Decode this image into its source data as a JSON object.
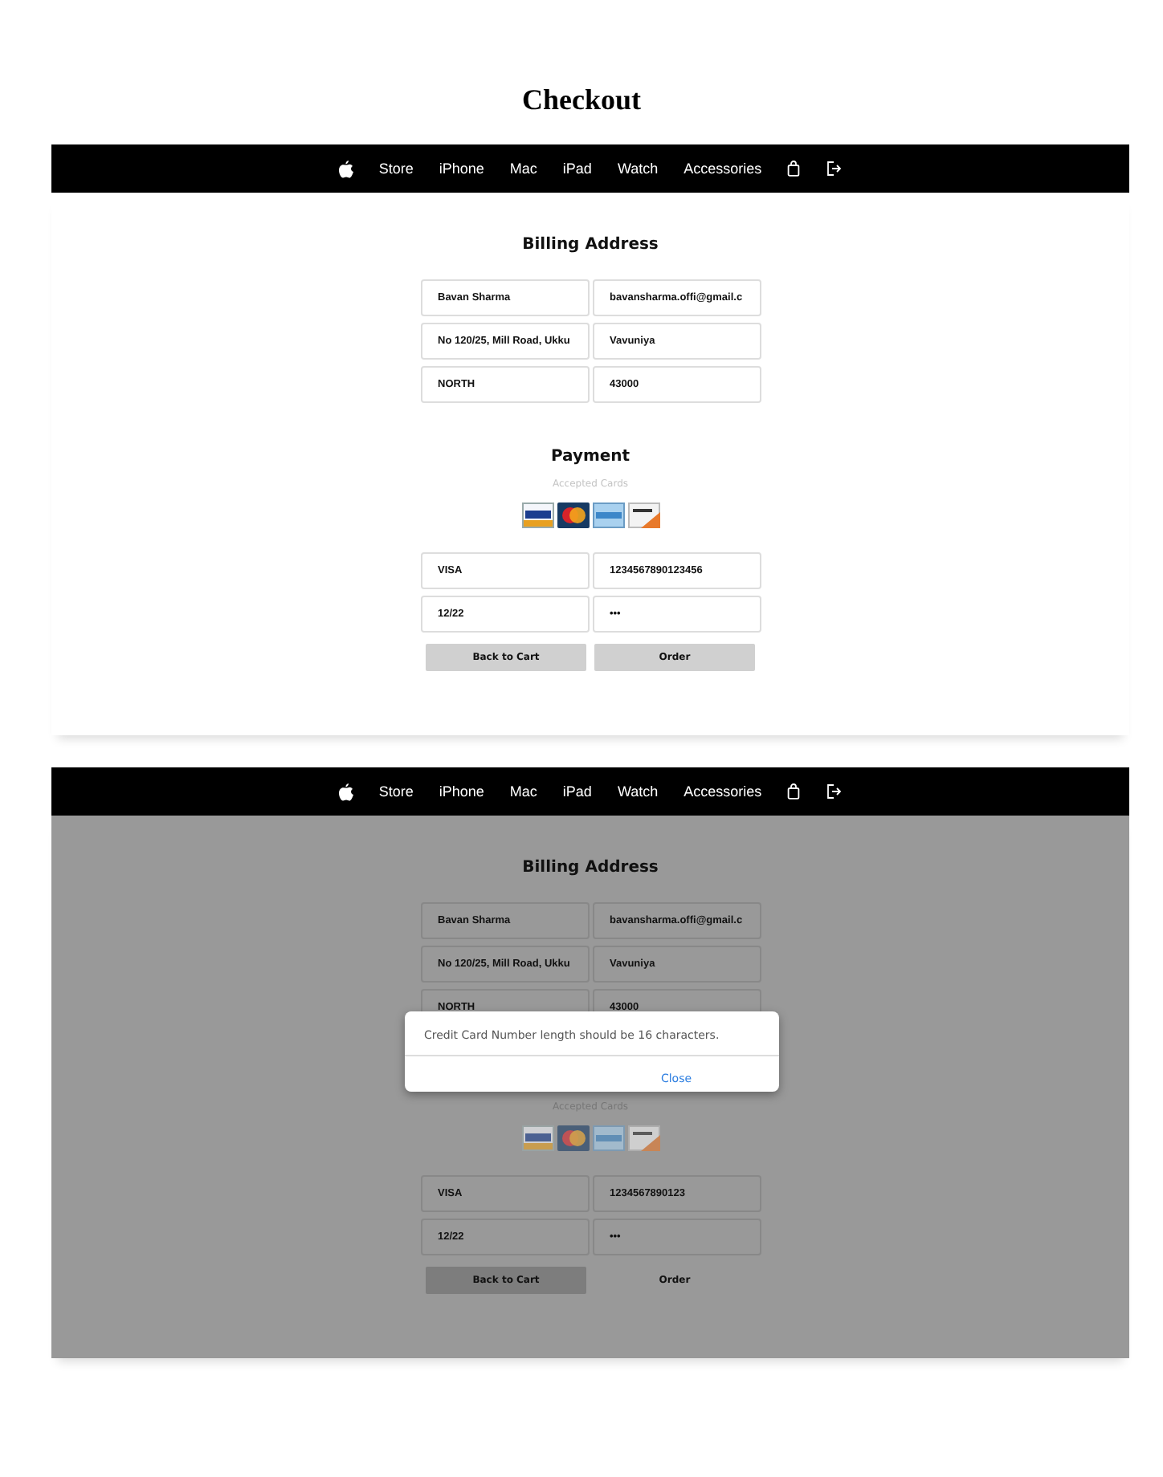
{
  "title": "Checkout",
  "screens": [
    {
      "dimmed": false,
      "nav": [
        "Store",
        "iPhone",
        "Mac",
        "iPad",
        "Watch",
        "Accessories"
      ],
      "billing": {
        "title": "Billing Address",
        "fields": [
          "Bavan Sharma",
          "bavansharma.offi@gmail.c",
          "No 120/25, Mill Road, Ukku",
          "Vavuniya",
          "NORTH",
          "43000"
        ]
      },
      "payment": {
        "title": "Payment",
        "caption": "Accepted Cards",
        "fields": [
          "VISA",
          "1234567890123456",
          "12/22",
          "•••"
        ]
      },
      "buttons": [
        {
          "label": "Back to Cart",
          "filled": true
        },
        {
          "label": "Order",
          "filled": true
        }
      ]
    },
    {
      "dimmed": true,
      "nav": [
        "Store",
        "iPhone",
        "Mac",
        "iPad",
        "Watch",
        "Accessories"
      ],
      "billing": {
        "title": "Billing Address",
        "fields": [
          "Bavan Sharma",
          "bavansharma.offi@gmail.c",
          "No 120/25, Mill Road, Ukku",
          "Vavuniya",
          "NORTH",
          "43000"
        ]
      },
      "payment": {
        "caption": "Accepted Cards",
        "fields": [
          "VISA",
          "1234567890123",
          "12/22",
          "•••"
        ]
      },
      "buttons": [
        {
          "label": "Back to Cart",
          "filled": true
        },
        {
          "label": "Order",
          "filled": false
        }
      ],
      "dialog": {
        "message": "Credit Card Number length should be 16 characters.",
        "action": "Close"
      }
    }
  ]
}
